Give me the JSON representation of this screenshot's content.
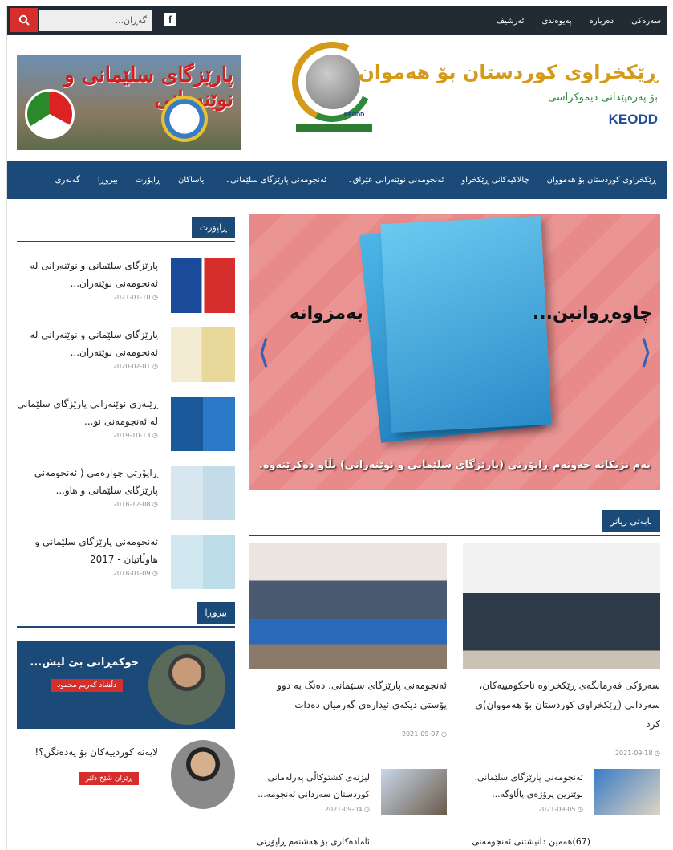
{
  "topbar": {
    "search_placeholder": "گەڕان...",
    "links": [
      "سەرەکی",
      "دەربارە",
      "پەیوەندی",
      "ئەرشیف"
    ]
  },
  "header": {
    "banner_title": "پارێزگای سلێمانی و نوێنەرانی",
    "org_name": "ڕێکخراوی کوردستان بۆ هەموان",
    "org_sub": "بۆ پەرەپێدانی دیموکراسی",
    "org_abbr": "KEODD",
    "logo_text": "KEODD"
  },
  "nav": [
    {
      "label": "ڕێکخراوی کوردستان بۆ هەمووان",
      "dropdown": false
    },
    {
      "label": "چالاکیەکانی ڕێکخراو",
      "dropdown": false
    },
    {
      "label": "ئەنجومەنی نوێنەرانی عێراق",
      "dropdown": true
    },
    {
      "label": "ئەنجومەنی پارێزگای سلێمانی",
      "dropdown": true
    },
    {
      "label": "یاساکان",
      "dropdown": false
    },
    {
      "label": "ڕاپۆرت",
      "dropdown": false
    },
    {
      "label": "بیروڕا",
      "dropdown": false
    },
    {
      "label": "گەلەری",
      "dropdown": false
    }
  ],
  "sidebar": {
    "report_heading": "ڕاپۆرت",
    "reports": [
      {
        "title": "پارێزگای سلێمانی و نوێنەرانی لە ئەنجومەنی نوێنەران...",
        "date": "2021-01-10"
      },
      {
        "title": "پارێزگای سلێمانی و نوێنەرانی لە ئەنجومەنی نوێنەران...",
        "date": "2020-02-01"
      },
      {
        "title": "ڕێبەری نوێنەرانی پارێزگای سلێمانی لە ئەنجومەنی نو...",
        "date": "2019-10-13"
      },
      {
        "title": "ڕاپۆرتی چوارەمی ( ئەنجومەنی پارێزگای سلێمانی و هاو...",
        "date": "2018-12-08"
      },
      {
        "title": "ئەنجومەنی پارێزگای سلێمانی و هاوڵاتیان - 2017",
        "date": "2018-01-09"
      }
    ],
    "opinion_heading": "بیروڕا",
    "opinion_main": {
      "title": "حوکمڕانی بێ لیش...",
      "author": "دڵشاد کەریم محمود"
    },
    "opinion_second": {
      "title": "لایەنە کوردییەکان بۆ یەدەنگن؟!",
      "author": "ڕێزان شێخ دلێر"
    }
  },
  "slider": {
    "left_text": "بەمزوانە",
    "right_text": "چاوەڕوانبن...",
    "caption": "بەم نزیکانە حەوتەم ڕاپۆرتی (پارێزگای سلێمانی و نوێنەرانی) بڵاو دەکرێتەوە."
  },
  "more": {
    "heading": "بابەتی زیاتر",
    "featured": [
      {
        "title": "سەرۆکی فەرمانگەی ڕێکخراوە ناحکومییەکان، سەردانی (ڕێکخراوی کوردستان بۆ هەمووان)ی کرد",
        "date": "2021-09-18"
      },
      {
        "title": "ئەنجومەنی پارێزگای سلێمانی، دەنگ بە دوو پۆستی دیکەی ئیدارەی گەرمیان دەدات",
        "date": "2021-09-07"
      }
    ],
    "small": [
      {
        "title": "ئەنجومەنی پارێزگای سلێمانی، نوێترین پرۆژەی پاڵاوگە...",
        "date": "2021-09-05"
      },
      {
        "title": "لیژنەی کشتوکاڵی پەرلەمانی کوردستان سەردانی ئەنجومە...",
        "date": "2021-09-04"
      }
    ],
    "bottom": [
      "(67)هەمین دانیشتنی ئەنجومەنی",
      "ئامادەکاری بۆ هەشتەم ڕاپۆرتی"
    ]
  }
}
